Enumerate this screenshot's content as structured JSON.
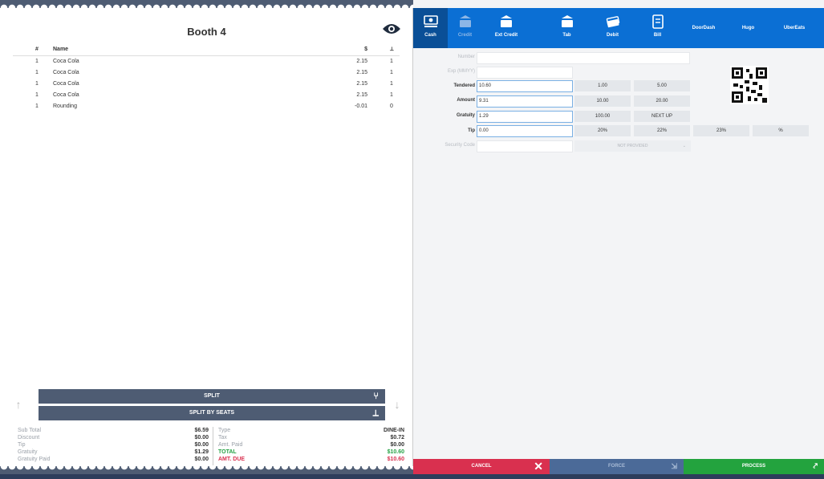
{
  "receipt": {
    "title": "Booth 4",
    "columns": {
      "num": "#",
      "name": "Name",
      "price": "$",
      "seat": "⟂"
    },
    "items": [
      {
        "num": "1",
        "name": "Coca Cola",
        "price": "2.15",
        "seat": "1"
      },
      {
        "num": "1",
        "name": "Coca Cola",
        "price": "2.15",
        "seat": "1"
      },
      {
        "num": "1",
        "name": "Coca Cola",
        "price": "2.15",
        "seat": "1"
      },
      {
        "num": "1",
        "name": "Coca Cola",
        "price": "2.15",
        "seat": "1"
      },
      {
        "num": "1",
        "name": "Rounding",
        "price": "-0.01",
        "seat": "0"
      }
    ],
    "split_label": "SPLIT",
    "split_by_seats_label": "SPLIT BY SEATS",
    "totals_left": [
      {
        "label": "Sub Total",
        "value": "$6.59"
      },
      {
        "label": "Discount",
        "value": "$0.00"
      },
      {
        "label": "Tip",
        "value": "$0.00"
      },
      {
        "label": "Gratuity",
        "value": "$1.29"
      },
      {
        "label": "Gratuity Paid",
        "value": "$0.00"
      }
    ],
    "totals_right": [
      {
        "label": "Type",
        "value": "DINE-IN"
      },
      {
        "label": "Tax",
        "value": "$0.72"
      },
      {
        "label": "Amt. Paid",
        "value": "$0.00"
      },
      {
        "label": "TOTAL",
        "value": "$10.60"
      },
      {
        "label": "AMT. DUE",
        "value": "$10.60"
      }
    ]
  },
  "payment_tabs": [
    {
      "label": "Cash",
      "icon": "cash-icon",
      "state": "active"
    },
    {
      "label": "Credit",
      "icon": "credit-card-icon",
      "state": "disabled"
    },
    {
      "label": "Ext Credit",
      "icon": "ext-credit-icon",
      "state": "normal"
    },
    {
      "label": "Tab",
      "icon": "tab-icon",
      "state": "normal"
    },
    {
      "label": "Debit",
      "icon": "debit-icon",
      "state": "normal"
    },
    {
      "label": "Bill",
      "icon": "bill-icon",
      "state": "normal"
    },
    {
      "label": "DoorDash",
      "icon": "",
      "state": "normal"
    },
    {
      "label": "Hugo",
      "icon": "",
      "state": "normal"
    },
    {
      "label": "UberEats",
      "icon": "",
      "state": "normal"
    }
  ],
  "form": {
    "number_label": "Number",
    "number_value": "",
    "exp_label": "Exp (MMYY)",
    "exp_value": "",
    "tendered_label": "Tendered",
    "tendered_value": "10.60",
    "amount_label": "Amount",
    "amount_value": "9.31",
    "gratuity_label": "Gratuity",
    "gratuity_value": "1.29",
    "tip_label": "Tip",
    "tip_value": "0.00",
    "security_label": "Security Code",
    "security_value": "",
    "security_select": "NOT PROVIDED",
    "quick_amounts": [
      "1.00",
      "5.00",
      "10.00",
      "20.00",
      "100.00",
      "NEXT UP"
    ],
    "tip_options": [
      "20%",
      "22%",
      "23%",
      "%"
    ]
  },
  "actions": {
    "cancel": "CANCEL",
    "force": "FORCE",
    "process": "PROCESS"
  },
  "colors": {
    "tab_bar": "#0b6fd4",
    "cancel": "#d9304f",
    "force": "#4b6a98",
    "process": "#23a33e",
    "split": "#4e5c73"
  }
}
